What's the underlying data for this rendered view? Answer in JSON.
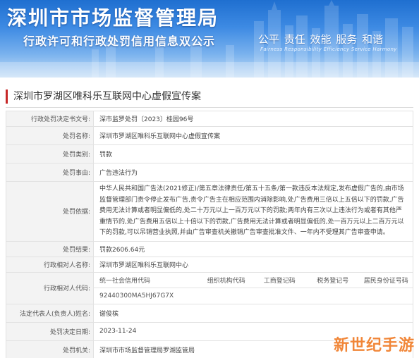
{
  "banner": {
    "title": "深圳市市场监督管理局",
    "subtitle": "行政许可和行政处罚信用信息双公示",
    "slogan": "公平  责任  效能  服务  和谐",
    "slogan_en": "Fairness  Responsibility  Efficiency  Service  Harmony"
  },
  "case_title": "深圳市罗湖区唯科乐互联网中心虚假宣传案",
  "rows": {
    "decision_no": {
      "label": "行政处罚决定书文号:",
      "value": "深市监罗处罚〔2023〕桂园96号"
    },
    "case_name": {
      "label": "处罚名称:",
      "value": "深圳市罗湖区唯科乐互联网中心虚假宣传案"
    },
    "category": {
      "label": "处罚类别:",
      "value": "罚款"
    },
    "reason": {
      "label": "处罚事由:",
      "value": "广告违法行为"
    },
    "basis": {
      "label": "处罚依据:",
      "value": "中华人民共和国广告法(2021修正)/第五章法律责任/第五十五条/第一款违反本法规定,发布虚假广告的,由市场监督管理部门责令停止发布广告,责令广告主在相应范围内消除影响,处广告费用三倍以上五倍以下的罚款,广告费用无法计算或者明显偏低的,处二十万元以上一百万元以下的罚款;两年内有三次以上违法行为或者有其他严重情节的,处广告费用五倍以上十倍以下的罚款,广告费用无法计算或者明显偏低的,处一百万元以上二百万元以下的罚款,可以吊销营业执照,并由广告审查机关撤销广告审查批准文件、一年内不受理其广告审查申请。"
    },
    "result": {
      "label": "处罚结果:",
      "value": "罚款2606.64元"
    },
    "counterpart_name": {
      "label": "行政相对人名称:",
      "value": "深圳市罗湖区唯科乐互联网中心"
    },
    "counterpart_code": {
      "label": "行政相对人代码:",
      "headers": [
        "统一社会信用代码",
        "组织机构代码",
        "工商登记码",
        "税务登记号",
        "居民身份证号码"
      ],
      "values": [
        "92440300MA5HJ67G7X",
        "",
        "",
        "",
        ""
      ]
    },
    "legal_rep": {
      "label": "法定代表人(负责人)姓名:",
      "value": "谢俊槟"
    },
    "decision_date": {
      "label": "处罚决定日期:",
      "value": "2023-11-24"
    },
    "authority": {
      "label": "处罚机关:",
      "value": "深圳市市场监督管理局罗湖监管局"
    }
  },
  "watermark": "新世纪手游",
  "colors": {
    "banner_blue": "#1f6fd0",
    "accent_red": "#c62828",
    "label_bg": "#f3f3f3",
    "border": "#e2e2e2",
    "watermark": "#f07a23"
  }
}
